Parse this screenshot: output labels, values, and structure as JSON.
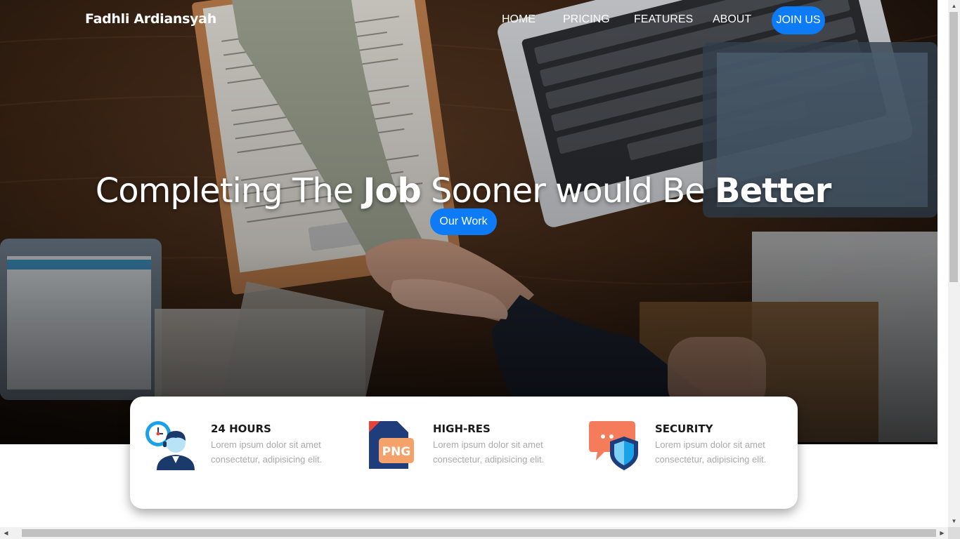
{
  "brand": "Fadhli Ardiansyah",
  "nav": {
    "items": [
      "HOME",
      "PRICING",
      "FEATURES",
      "ABOUT"
    ],
    "join_label": "JOIN US"
  },
  "hero": {
    "headline_1": "Completing The ",
    "headline_2": "Job",
    "headline_3": " Sooner would Be ",
    "headline_4": "Better",
    "cta_label": "Our Work"
  },
  "features": [
    {
      "icon": "clock-support-agent-icon",
      "title": "24 HOURS",
      "text": "Lorem ipsum dolor sit amet consectetur, adipisicing elit."
    },
    {
      "icon": "png-file-icon",
      "title": "HIGH-RES",
      "text": "Lorem ipsum dolor sit amet consectetur, adipisicing elit."
    },
    {
      "icon": "chat-shield-icon",
      "title": "SECURITY",
      "text": "Lorem ipsum dolor sit amet consectetur, adipisicing elit."
    }
  ],
  "png_badge": "PNG",
  "colors": {
    "accent": "#0d7bf5",
    "muted_text": "#a9a9a9"
  }
}
